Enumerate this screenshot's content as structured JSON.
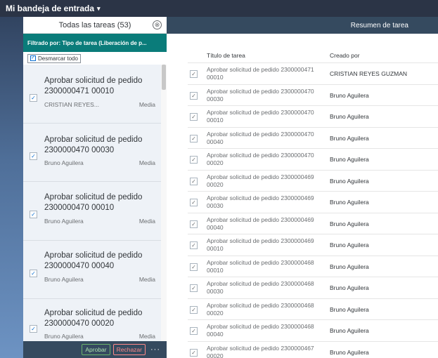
{
  "topbar": {
    "title": "Mi bandeja de entrada",
    "caret": "▾"
  },
  "master": {
    "title": "Todas las tareas (53)",
    "close_icon": "⊗",
    "filter": "Filtrado por: Tipo de tarea (Liberación de p...",
    "unmark_label": "Desmarcar todo",
    "items": [
      {
        "title": "Aprobar solicitud de pedido 2300000471 00010",
        "author": "CRISTIAN REYES...",
        "priority": "Media"
      },
      {
        "title": "Aprobar solicitud de pedido 2300000470 00030",
        "author": "Bruno Aguilera",
        "priority": "Media"
      },
      {
        "title": "Aprobar solicitud de pedido 2300000470 00010",
        "author": "Bruno Aguilera",
        "priority": "Media"
      },
      {
        "title": "Aprobar solicitud de pedido 2300000470 00040",
        "author": "Bruno Aguilera",
        "priority": "Media"
      },
      {
        "title": "Aprobar solicitud de pedido 2300000470 00020",
        "author": "Bruno Aguilera",
        "priority": "Media"
      }
    ],
    "footer": {
      "approve": "Aprobar",
      "reject": "Rechazar",
      "more": "···"
    }
  },
  "detail": {
    "header": "Resumen de tarea",
    "columns": {
      "title": "Título de tarea",
      "created_by": "Creado por"
    },
    "rows": [
      {
        "line1": "Aprobar solicitud de pedido 2300000471",
        "line2": "00010",
        "author": "CRISTIAN REYES GUZMAN"
      },
      {
        "line1": "Aprobar solicitud de pedido 2300000470",
        "line2": "00030",
        "author": "Bruno Aguilera"
      },
      {
        "line1": "Aprobar solicitud de pedido 2300000470",
        "line2": "00010",
        "author": "Bruno Aguilera"
      },
      {
        "line1": "Aprobar solicitud de pedido 2300000470",
        "line2": "00040",
        "author": "Bruno Aguilera"
      },
      {
        "line1": "Aprobar solicitud de pedido 2300000470",
        "line2": "00020",
        "author": "Bruno Aguilera"
      },
      {
        "line1": "Aprobar solicitud de pedido 2300000469",
        "line2": "00020",
        "author": "Bruno Aguilera"
      },
      {
        "line1": "Aprobar solicitud de pedido 2300000469",
        "line2": "00030",
        "author": "Bruno Aguilera"
      },
      {
        "line1": "Aprobar solicitud de pedido 2300000469",
        "line2": "00040",
        "author": "Bruno Aguilera"
      },
      {
        "line1": "Aprobar solicitud de pedido 2300000469",
        "line2": "00010",
        "author": "Bruno Aguilera"
      },
      {
        "line1": "Aprobar solicitud de pedido 2300000468",
        "line2": "00010",
        "author": "Bruno Aguilera"
      },
      {
        "line1": "Aprobar solicitud de pedido 2300000468",
        "line2": "00030",
        "author": "Bruno Aguilera"
      },
      {
        "line1": "Aprobar solicitud de pedido 2300000468",
        "line2": "00020",
        "author": "Bruno Aguilera"
      },
      {
        "line1": "Aprobar solicitud de pedido 2300000468",
        "line2": "00040",
        "author": "Bruno Aguilera"
      },
      {
        "line1": "Aprobar solicitud de pedido 2300000467",
        "line2": "00020",
        "author": "Bruno Aguilera"
      }
    ]
  },
  "check_glyph": "✓",
  "colors": {
    "accent": "#0a7c7a",
    "shell": "#354a5f",
    "approve": "#6bb36b",
    "reject": "#ff8888"
  }
}
